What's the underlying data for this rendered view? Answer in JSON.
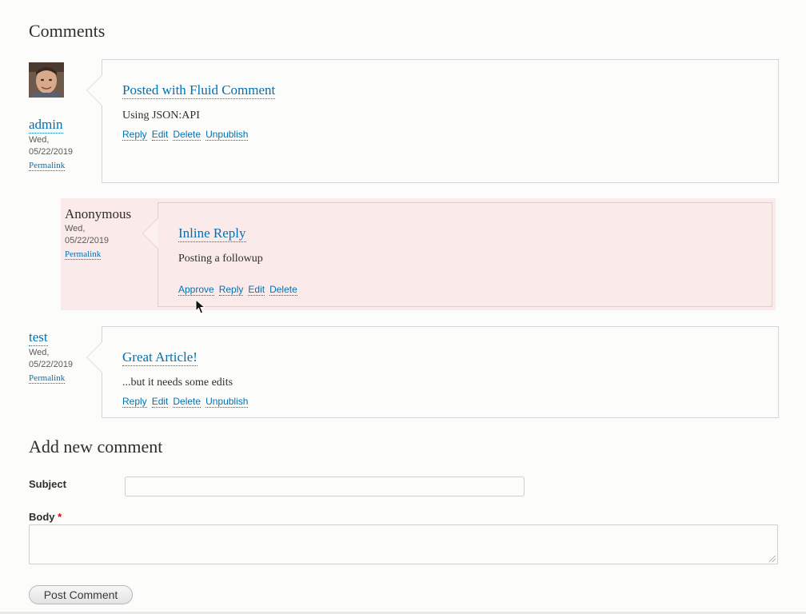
{
  "comments_heading": "Comments",
  "comments": [
    {
      "author": "admin",
      "date": "Wed,\n05/22/2019",
      "permalink": "Permalink",
      "title": "Posted with Fluid Comment",
      "body": "Using JSON:API",
      "links": [
        "Reply",
        "Edit",
        "Delete",
        "Unpublish"
      ]
    },
    {
      "author": "Anonymous",
      "date": "Wed,\n05/22/2019",
      "permalink": "Permalink",
      "title": "Inline Reply",
      "body": "Posting a followup",
      "links": [
        "Approve",
        "Reply",
        "Edit",
        "Delete"
      ]
    },
    {
      "author": "test",
      "date": "Wed,\n05/22/2019",
      "permalink": "Permalink",
      "title": "Great Article!",
      "body": "...but it needs some edits",
      "links": [
        "Reply",
        "Edit",
        "Delete",
        "Unpublish"
      ]
    }
  ],
  "form": {
    "heading": "Add new comment",
    "subject_label": "Subject",
    "subject_value": "",
    "body_label": "Body",
    "required_mark": "*",
    "body_value": "",
    "submit_label": "Post Comment"
  },
  "colors": {
    "link": "#0071b3",
    "unpublished_bg": "#fbeaea",
    "required": "#ee0000"
  }
}
